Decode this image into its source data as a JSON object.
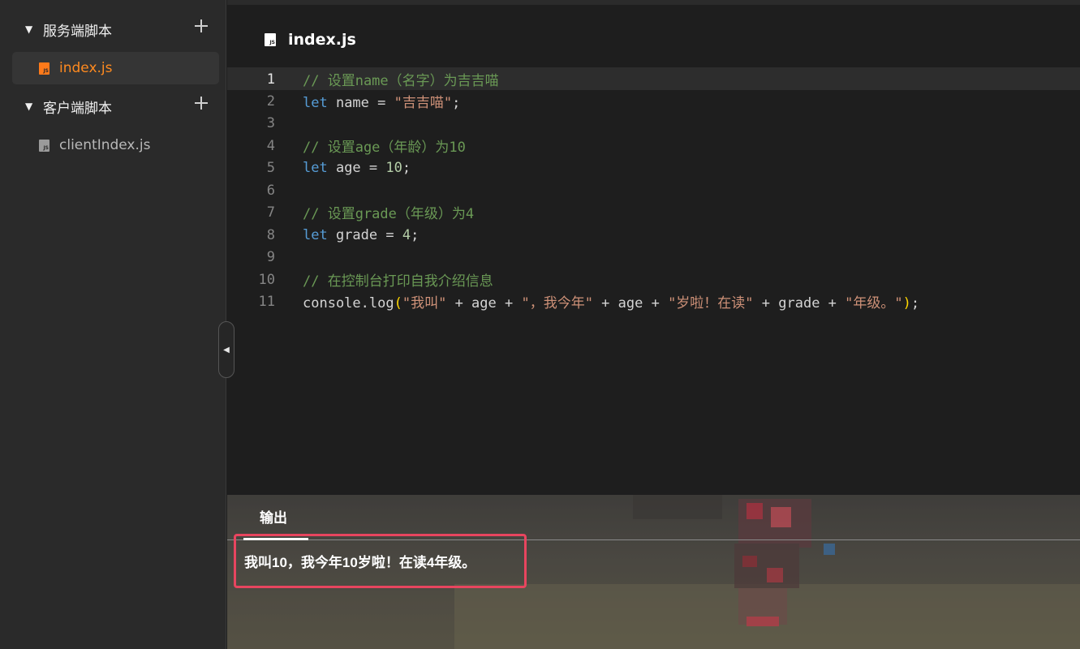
{
  "sidebar": {
    "server_folder": {
      "label": "服务端脚本",
      "add_icon": "plus-icon",
      "toggle_icon": "caret-down-icon"
    },
    "server_files": [
      {
        "name": "index.js",
        "icon": "js-file-icon",
        "active": true
      }
    ],
    "client_folder": {
      "label": "客户端脚本",
      "add_icon": "plus-icon",
      "toggle_icon": "caret-down-icon"
    },
    "client_files": [
      {
        "name": "clientIndex.js",
        "icon": "js-file-icon",
        "active": false
      }
    ],
    "collapse_icon": "caret-left-icon"
  },
  "editor": {
    "tab_title": "index.js",
    "tab_icon": "js-file-icon",
    "current_line": 1,
    "lines": [
      {
        "num": "1",
        "text": "// 设置name（名字）为吉吉喵"
      },
      {
        "num": "2",
        "text": "let name = \"吉吉喵\";"
      },
      {
        "num": "3",
        "text": ""
      },
      {
        "num": "4",
        "text": "// 设置age（年龄）为10"
      },
      {
        "num": "5",
        "text": "let age = 10;"
      },
      {
        "num": "6",
        "text": ""
      },
      {
        "num": "7",
        "text": "// 设置grade（年级）为4"
      },
      {
        "num": "8",
        "text": "let grade = 4;"
      },
      {
        "num": "9",
        "text": ""
      },
      {
        "num": "10",
        "text": "// 在控制台打印自我介绍信息"
      },
      {
        "num": "11",
        "text": "console.log(\"我叫\" + age + \"，我今年\" + age + \"岁啦！在读\" + grade + \"年级。\");"
      }
    ]
  },
  "output": {
    "tab_label": "输出",
    "text": "我叫10，我今年10岁啦！在读4年级。"
  },
  "colors": {
    "accent": "#ff8a1f",
    "highlight_border": "#e8455f",
    "comment": "#6a9955",
    "keyword": "#569cd6",
    "string": "#ce9178",
    "number": "#b5cea8"
  }
}
